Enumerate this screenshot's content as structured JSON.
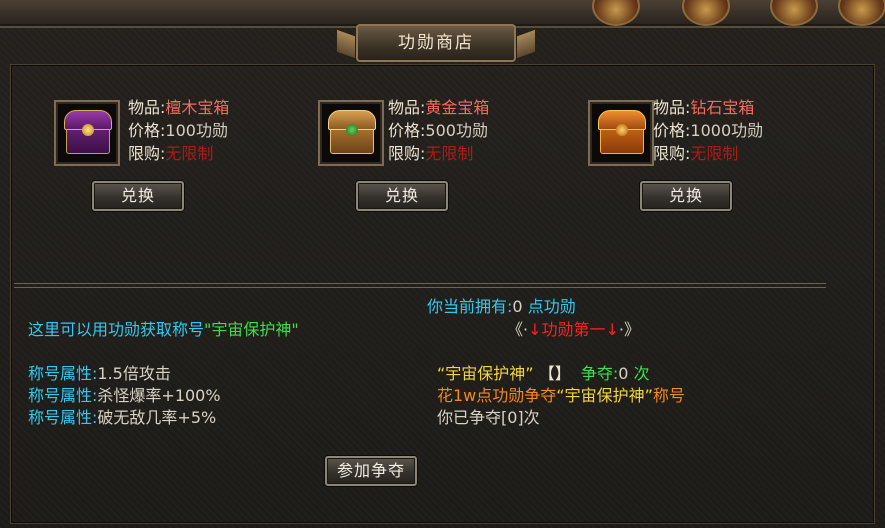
{
  "window": {
    "title": "功勋商店"
  },
  "shop": {
    "items": [
      {
        "icon": "purple-chest-icon",
        "name_label": "物品:",
        "name": "檀木宝箱",
        "price_label": "价格:",
        "price": "100功勋",
        "limit_label": "限购:",
        "limit": "无限制",
        "button": "兑换"
      },
      {
        "icon": "gold-chest-icon",
        "name_label": "物品:",
        "name": "黄金宝箱",
        "price_label": "价格:",
        "price": "500功勋",
        "limit_label": "限购:",
        "limit": "无限制",
        "button": "兑换"
      },
      {
        "icon": "orange-chest-icon",
        "name_label": "物品:",
        "name": "钻石宝箱",
        "price_label": "价格:",
        "price": "1000功勋",
        "limit_label": "限购:",
        "limit": "无限制",
        "button": "兑换"
      }
    ]
  },
  "info": {
    "owned_prefix": "你当前拥有:",
    "owned_value": "0",
    "owned_suffix": "点功勋",
    "intro_prefix": "这里可以用功勋获取称号",
    "intro_title": "\"宇宙保护神\"",
    "rank_open": "《·",
    "rank_arrow_left": "↓",
    "rank_label": "功勋第一",
    "rank_arrow_right": "↓",
    "rank_close": "·》",
    "attributes": [
      {
        "label": "称号属性:",
        "value": "1.5倍攻击"
      },
      {
        "label": "称号属性:",
        "value": "杀怪爆率+100%"
      },
      {
        "label": "称号属性:",
        "value": "破无敌几率+5%"
      }
    ],
    "title_name": "“宇宙保护神”",
    "holder_brackets": "【】",
    "contest_label": "争夺:",
    "contest_value": "0",
    "contest_unit": "次",
    "cost_prefix": "花1w点功勋争夺",
    "cost_title": "“宇宙保护神”",
    "cost_suffix": "称号",
    "my_contests": "你已争夺[0]次",
    "join_button": "参加争夺"
  },
  "colors": {
    "accent_cyan": "#33c9f0",
    "accent_green": "#3be04a",
    "accent_yellow": "#f1d63c",
    "accent_orange": "#f28a1e",
    "item_name_red": "#f26c62",
    "limit_red": "#b21a14"
  }
}
